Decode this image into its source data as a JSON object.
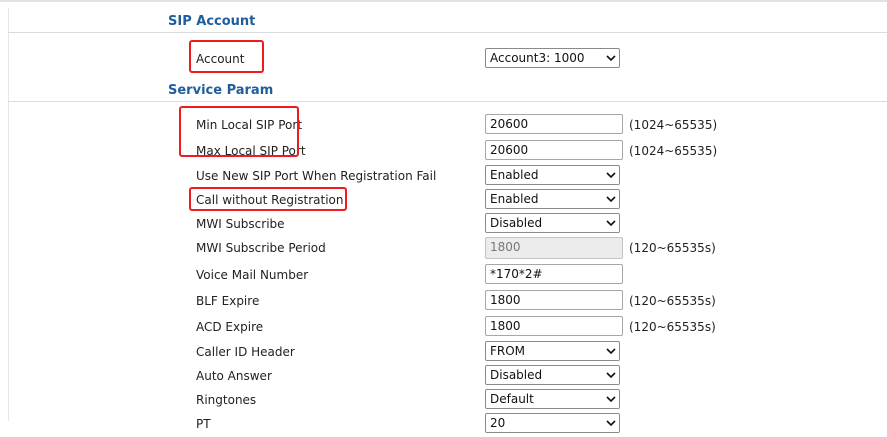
{
  "sections": {
    "sip_account": "SIP Account",
    "service_param": "Service Param"
  },
  "account": {
    "label": "Account",
    "value": "Account3: 1000"
  },
  "rows": {
    "min_port": {
      "label": "Min Local SIP Port",
      "value": "20600",
      "range": "(1024~65535)"
    },
    "max_port": {
      "label": "Max Local SIP Port",
      "value": "20600",
      "range": "(1024~65535)"
    },
    "new_port": {
      "label": "Use New SIP Port When Registration Fail",
      "value": "Enabled"
    },
    "call_wo_reg": {
      "label": "Call without Registration",
      "value": "Enabled"
    },
    "mwi_sub": {
      "label": "MWI Subscribe",
      "value": "Disabled"
    },
    "mwi_period": {
      "label": "MWI Subscribe Period",
      "value": "1800",
      "range": "(120~65535s)"
    },
    "voicemail": {
      "label": "Voice Mail Number",
      "value": "*170*2#"
    },
    "blf_expire": {
      "label": "BLF Expire",
      "value": "1800",
      "range": "(120~65535s)"
    },
    "acd_expire": {
      "label": "ACD Expire",
      "value": "1800",
      "range": "(120~65535s)"
    },
    "caller_id": {
      "label": "Caller ID Header",
      "value": "FROM"
    },
    "auto_answer": {
      "label": "Auto Answer",
      "value": "Disabled"
    },
    "ringtones": {
      "label": "Ringtones",
      "value": "Default"
    },
    "partial": {
      "label": "PT",
      "value": "20"
    }
  },
  "colors": {
    "section_title": "#1f5e9a",
    "highlight": "#ee1c1c"
  }
}
